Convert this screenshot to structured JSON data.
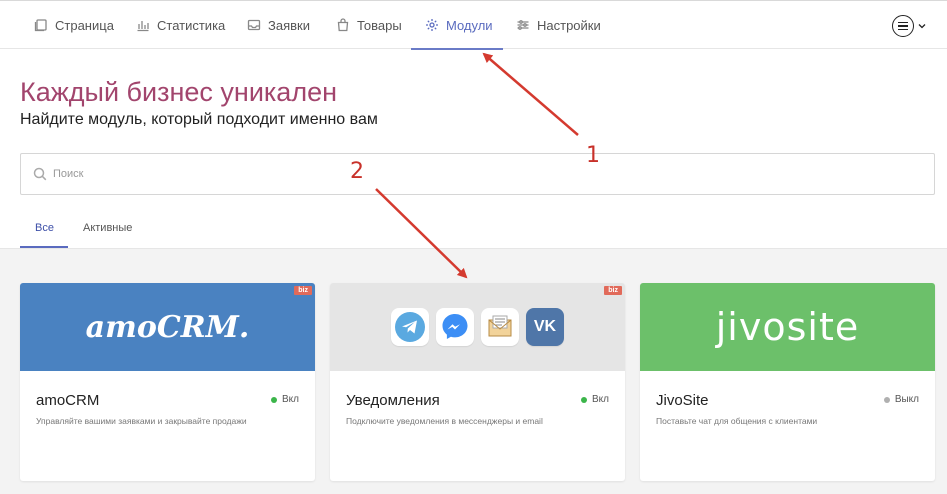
{
  "nav": {
    "items": [
      {
        "label": "Страница",
        "icon": "page-icon"
      },
      {
        "label": "Статистика",
        "icon": "bar-chart-icon"
      },
      {
        "label": "Заявки",
        "icon": "inbox-icon"
      },
      {
        "label": "Товары",
        "icon": "shopping-bag-icon"
      },
      {
        "label": "Модули",
        "icon": "gear-icon",
        "active": true
      },
      {
        "label": "Настройки",
        "icon": "sliders-icon"
      }
    ],
    "menu_icon": "hamburger-circle-icon"
  },
  "header": {
    "title": "Каждый бизнес уникален",
    "subtitle": "Найдите модуль, который подходит именно вам"
  },
  "search": {
    "placeholder": "Поиск",
    "value": ""
  },
  "tabs": [
    {
      "label": "Все",
      "active": true
    },
    {
      "label": "Активные"
    }
  ],
  "cards": [
    {
      "name": "amoCRM",
      "logo_text": "amoCRM.",
      "badge": "biz",
      "status": "Вкл",
      "status_color": "#3bb54a",
      "description": "Управляйте вашими заявками и закрывайте продажи",
      "banner_color": "#4a82c1"
    },
    {
      "name": "Уведомления",
      "badge": "biz",
      "status": "Вкл",
      "status_color": "#3bb54a",
      "description": "Подключите уведомления в мессенджеры и email",
      "banner_color": "#e5e5e5",
      "icons": [
        "telegram-icon",
        "messenger-icon",
        "email-icon",
        "vk-icon"
      ],
      "vk_text": "VK"
    },
    {
      "name": "JivoSite",
      "logo_text": "jivosite",
      "status": "Выкл",
      "status_color": "#b0b0b0",
      "description": "Поставьте чат для общения с клиентами",
      "banner_color": "#6cc06a"
    }
  ],
  "annotations": [
    {
      "label": "1",
      "color": "#d43a2f"
    },
    {
      "label": "2",
      "color": "#d43a2f"
    }
  ],
  "colors": {
    "accent": "#5a6bbf",
    "title": "#a2456d",
    "bg": "#f3f3f3"
  }
}
